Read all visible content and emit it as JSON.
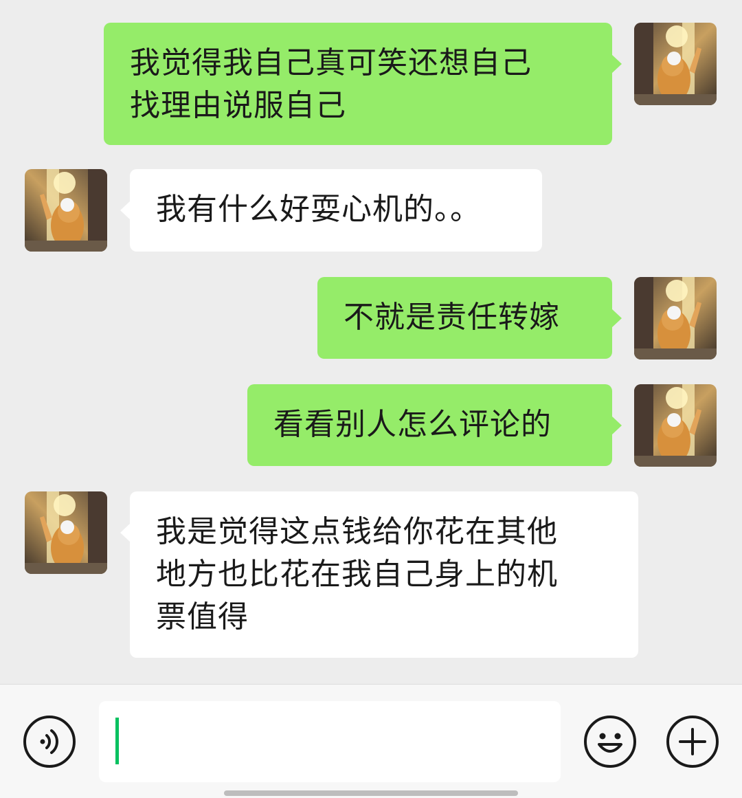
{
  "messages": [
    {
      "side": "me",
      "text": "我觉得我自己真可笑还想自己\n找理由说服自己"
    },
    {
      "side": "them",
      "text": "我有什么好耍心机的。。"
    },
    {
      "side": "me",
      "text": "不就是责任转嫁"
    },
    {
      "side": "me",
      "text": "看看别人怎么评论的"
    },
    {
      "side": "them",
      "text": "我是觉得这点钱给你花在其他\n地方也比花在我自己身上的机\n票值得"
    }
  ],
  "input": {
    "value": "",
    "accent": "#07c160"
  },
  "icons": {
    "voice": "voice-icon",
    "emoji": "emoji-icon",
    "more": "plus-icon"
  },
  "colors": {
    "me_bubble": "#95ec69",
    "them_bubble": "#ffffff",
    "background": "#ededed"
  }
}
